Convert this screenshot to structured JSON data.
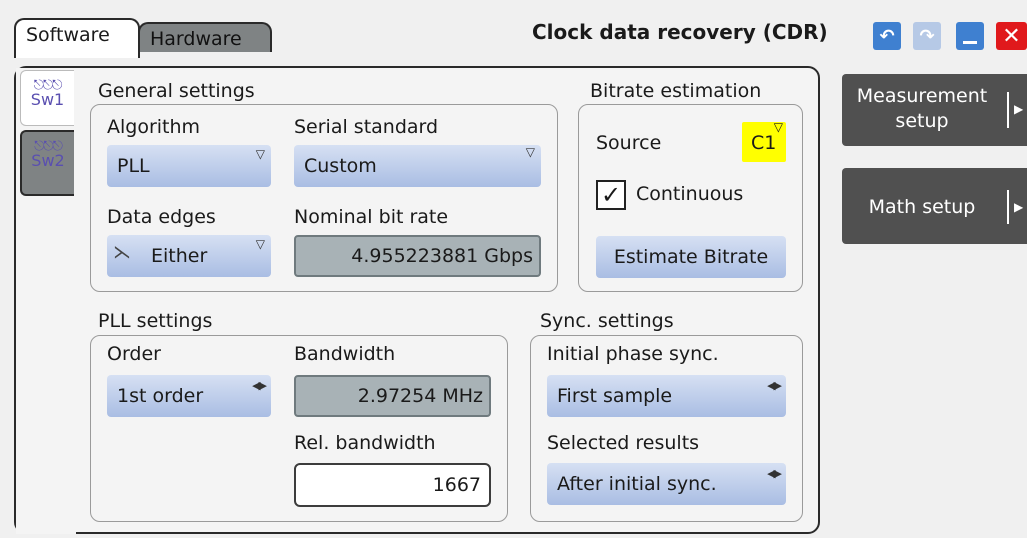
{
  "tabs": {
    "software": "Software",
    "hardware": "Hardware"
  },
  "window": {
    "title": "Clock data recovery (CDR)"
  },
  "subtabs": [
    {
      "label": "Sw1"
    },
    {
      "label": "Sw2"
    }
  ],
  "general": {
    "title": "General settings",
    "algorithm_label": "Algorithm",
    "algorithm_value": "PLL",
    "serial_label": "Serial standard",
    "serial_value": "Custom",
    "edges_label": "Data edges",
    "edges_value": "Either",
    "bitrate_label": "Nominal bit rate",
    "bitrate_value": "4.955223881 Gbps"
  },
  "bitrate": {
    "title": "Bitrate estimation",
    "source_label": "Source",
    "source_value": "C1",
    "continuous_label": "Continuous",
    "continuous_checked": true,
    "estimate_button": "Estimate Bitrate"
  },
  "pll": {
    "title": "PLL settings",
    "order_label": "Order",
    "order_value": "1st order",
    "bandwidth_label": "Bandwidth",
    "bandwidth_value": "2.97254 MHz",
    "relbw_label": "Rel. bandwidth",
    "relbw_value": "1667"
  },
  "sync": {
    "title": "Sync. settings",
    "initial_label": "Initial phase sync.",
    "initial_value": "First sample",
    "results_label": "Selected results",
    "results_value": "After initial sync."
  },
  "side": {
    "measurement_line1": "Measurement",
    "measurement_line2": "setup",
    "math": "Math setup"
  },
  "colors": {
    "dropdown": "#b9c9ea",
    "readonly": "#a8b2b6",
    "source_badge": "#ffff00",
    "close": "#e0191c",
    "title_button": "#4a8ed8"
  }
}
